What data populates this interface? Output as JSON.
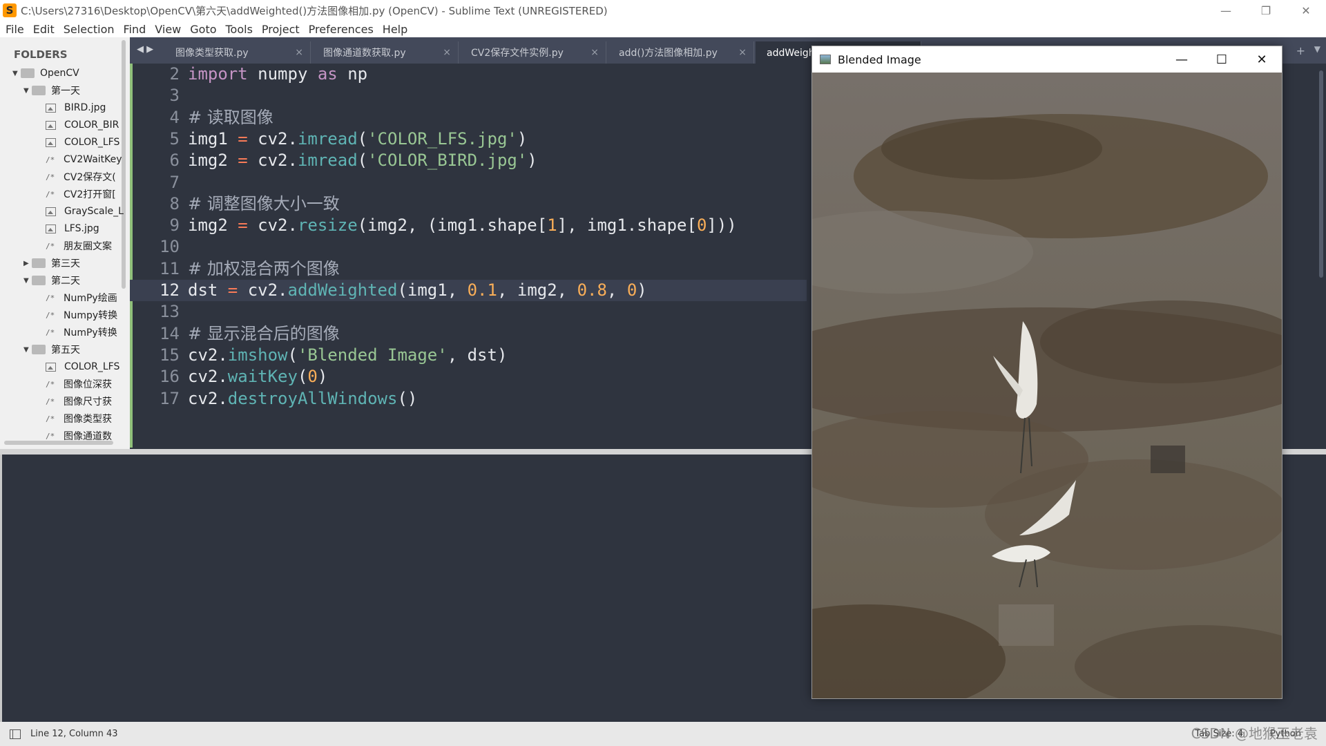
{
  "window": {
    "title": "C:\\Users\\27316\\Desktop\\OpenCV\\第六天\\addWeighted()方法图像相加.py (OpenCV) - Sublime Text (UNREGISTERED)",
    "minimize": "—",
    "restore": "❐",
    "close": "✕"
  },
  "menu": [
    "File",
    "Edit",
    "Selection",
    "Find",
    "View",
    "Goto",
    "Tools",
    "Project",
    "Preferences",
    "Help"
  ],
  "sidebar": {
    "title": "FOLDERS",
    "tree": [
      {
        "label": "OpenCV",
        "kind": "folder-open"
      },
      {
        "label": "第一天",
        "kind": "folder-open"
      },
      {
        "label": "BIRD.jpg",
        "kind": "image"
      },
      {
        "label": "COLOR_BIR",
        "kind": "image"
      },
      {
        "label": "COLOR_LFS",
        "kind": "image"
      },
      {
        "label": "CV2WaitKey",
        "kind": "code"
      },
      {
        "label": "CV2保存文(",
        "kind": "code"
      },
      {
        "label": "CV2打开窗[",
        "kind": "code"
      },
      {
        "label": "GrayScale_L",
        "kind": "image"
      },
      {
        "label": "LFS.jpg",
        "kind": "image"
      },
      {
        "label": "朋友圈文案",
        "kind": "code"
      },
      {
        "label": "第三天",
        "kind": "folder-closed"
      },
      {
        "label": "第二天",
        "kind": "folder-open"
      },
      {
        "label": "NumPy绘画",
        "kind": "code"
      },
      {
        "label": "Numpy转换",
        "kind": "code"
      },
      {
        "label": "NumPy转换",
        "kind": "code"
      },
      {
        "label": "第五天",
        "kind": "folder-open"
      },
      {
        "label": "COLOR_LFS",
        "kind": "image"
      },
      {
        "label": "图像位深获",
        "kind": "code"
      },
      {
        "label": "图像尺寸获",
        "kind": "code"
      },
      {
        "label": "图像类型获",
        "kind": "code"
      },
      {
        "label": "图像通道数",
        "kind": "code"
      }
    ]
  },
  "tabs": {
    "nav": "◀ ▶",
    "items": [
      {
        "label": "图像类型获取.py",
        "close": "×"
      },
      {
        "label": "图像通道数获取.py",
        "close": "×"
      },
      {
        "label": "CV2保存文件实例.py",
        "close": "×"
      },
      {
        "label": "add()方法图像相加.py",
        "close": "×"
      },
      {
        "label": "addWeighted()方法图像相加.py",
        "close": "×"
      }
    ],
    "plus": "+",
    "dropdown": "▼"
  },
  "editor": {
    "current_line": 12,
    "lines": [
      {
        "n": "2",
        "tokens": [
          {
            "t": "kw",
            "v": "import"
          },
          {
            "t": "p",
            "v": " numpy "
          },
          {
            "t": "kw",
            "v": "as"
          },
          {
            "t": "p",
            "v": " np"
          }
        ]
      },
      {
        "n": "3",
        "tokens": []
      },
      {
        "n": "4",
        "tokens": [
          {
            "t": "cm",
            "v": "# 读取图像"
          }
        ]
      },
      {
        "n": "5",
        "tokens": [
          {
            "t": "p",
            "v": "img1 "
          },
          {
            "t": "op",
            "v": "="
          },
          {
            "t": "p",
            "v": " cv2."
          },
          {
            "t": "fn",
            "v": "imread"
          },
          {
            "t": "p",
            "v": "("
          },
          {
            "t": "str",
            "v": "'COLOR_LFS.jpg'"
          },
          {
            "t": "p",
            "v": ")"
          }
        ]
      },
      {
        "n": "6",
        "tokens": [
          {
            "t": "p",
            "v": "img2 "
          },
          {
            "t": "op",
            "v": "="
          },
          {
            "t": "p",
            "v": " cv2."
          },
          {
            "t": "fn",
            "v": "imread"
          },
          {
            "t": "p",
            "v": "("
          },
          {
            "t": "str",
            "v": "'COLOR_BIRD.jpg'"
          },
          {
            "t": "p",
            "v": ")"
          }
        ]
      },
      {
        "n": "7",
        "tokens": []
      },
      {
        "n": "8",
        "tokens": [
          {
            "t": "cm",
            "v": "# 调整图像大小一致"
          }
        ]
      },
      {
        "n": "9",
        "tokens": [
          {
            "t": "p",
            "v": "img2 "
          },
          {
            "t": "op",
            "v": "="
          },
          {
            "t": "p",
            "v": " cv2."
          },
          {
            "t": "fn",
            "v": "resize"
          },
          {
            "t": "p",
            "v": "(img2, (img1.shape["
          },
          {
            "t": "num",
            "v": "1"
          },
          {
            "t": "p",
            "v": "], img1.shape["
          },
          {
            "t": "num",
            "v": "0"
          },
          {
            "t": "p",
            "v": "]))"
          }
        ]
      },
      {
        "n": "10",
        "tokens": []
      },
      {
        "n": "11",
        "tokens": [
          {
            "t": "cm",
            "v": "# 加权混合两个图像"
          }
        ]
      },
      {
        "n": "12",
        "tokens": [
          {
            "t": "p",
            "v": "dst "
          },
          {
            "t": "op",
            "v": "="
          },
          {
            "t": "p",
            "v": " cv2."
          },
          {
            "t": "fn",
            "v": "addWeighted"
          },
          {
            "t": "p",
            "v": "(img1, "
          },
          {
            "t": "num",
            "v": "0.1"
          },
          {
            "t": "p",
            "v": ", img2, "
          },
          {
            "t": "num",
            "v": "0.8"
          },
          {
            "t": "p",
            "v": ", "
          },
          {
            "t": "num",
            "v": "0"
          },
          {
            "t": "p",
            "v": ")"
          }
        ]
      },
      {
        "n": "13",
        "tokens": []
      },
      {
        "n": "14",
        "tokens": [
          {
            "t": "cm",
            "v": "# 显示混合后的图像"
          }
        ]
      },
      {
        "n": "15",
        "tokens": [
          {
            "t": "p",
            "v": "cv2."
          },
          {
            "t": "fn",
            "v": "imshow"
          },
          {
            "t": "p",
            "v": "("
          },
          {
            "t": "str",
            "v": "'Blended Image'"
          },
          {
            "t": "p",
            "v": ", dst)"
          }
        ]
      },
      {
        "n": "16",
        "tokens": [
          {
            "t": "p",
            "v": "cv2."
          },
          {
            "t": "fn",
            "v": "waitKey"
          },
          {
            "t": "p",
            "v": "("
          },
          {
            "t": "num",
            "v": "0"
          },
          {
            "t": "p",
            "v": ")"
          }
        ]
      },
      {
        "n": "17",
        "tokens": [
          {
            "t": "p",
            "v": "cv2."
          },
          {
            "t": "fn",
            "v": "destroyAllWindows"
          },
          {
            "t": "p",
            "v": "()"
          }
        ]
      }
    ]
  },
  "image_window": {
    "title": "Blended Image",
    "minimize": "—",
    "maximize": "☐",
    "close": "✕"
  },
  "status": {
    "position": "Line 12, Column 43",
    "tab_size": "Tab Size: 4",
    "syntax": "Python",
    "watermark": "CSDN @地猴玉老袁"
  },
  "colors": {
    "editor_bg": "#2f343f",
    "keyword": "#c594c5",
    "function": "#5fb4b4",
    "string": "#99c794",
    "number": "#f9ae58",
    "operator": "#f97b58"
  }
}
